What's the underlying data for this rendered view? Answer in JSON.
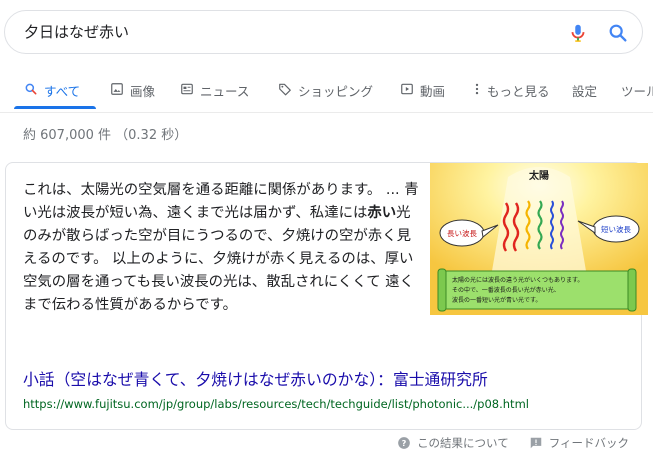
{
  "search": {
    "query": "夕日はなぜ赤い"
  },
  "tabs": [
    {
      "label": "すべて",
      "icon": "search-icon"
    },
    {
      "label": "画像",
      "icon": "image-icon"
    },
    {
      "label": "ニュース",
      "icon": "news-icon"
    },
    {
      "label": "ショッピング",
      "icon": "tag-icon"
    },
    {
      "label": "動画",
      "icon": "video-icon"
    },
    {
      "label": "もっと見る",
      "icon": "more-vert-icon"
    },
    {
      "label": "設定"
    },
    {
      "label": "ツール"
    }
  ],
  "stats": "約 607,000 件 （0.32 秒）",
  "answer": {
    "snippet_pre": "これは、太陽光の空気層を通る距離に関係があります。 ... 青い光は波長が短い為、遠くまで光は届かず、私達には",
    "snippet_bold": "赤い",
    "snippet_post": "光のみが散らばった空が目にうつるので、夕焼けの空が赤く見えるのです。 以上のように、夕焼けが赤く見えるのは、厚い空気の層を通っても長い波長の光は、散乱されにくくて 遠くまで伝わる性質があるからです。",
    "title": "小話（空はなぜ青くて、夕焼けはなぜ赤いのかな）：富士通研究所",
    "url": "https://www.fujitsu.com/jp/group/labs/resources/tech/techguide/list/photonic.../p08.html",
    "image": {
      "heading": "太陽",
      "long_label": "長い波長",
      "short_label": "短い波長",
      "caption_1": "太陽の光には波長の違う光がいくつもあります。",
      "caption_2": "その中で、一番波長の長い光が赤い光、",
      "caption_3": "波長の一番短い光が青い光です。"
    }
  },
  "footer": {
    "about": "この結果について",
    "feedback": "フィードバック"
  },
  "colors": {
    "link": "#1a0dab",
    "url": "#006621",
    "accent": "#1a73e8"
  }
}
